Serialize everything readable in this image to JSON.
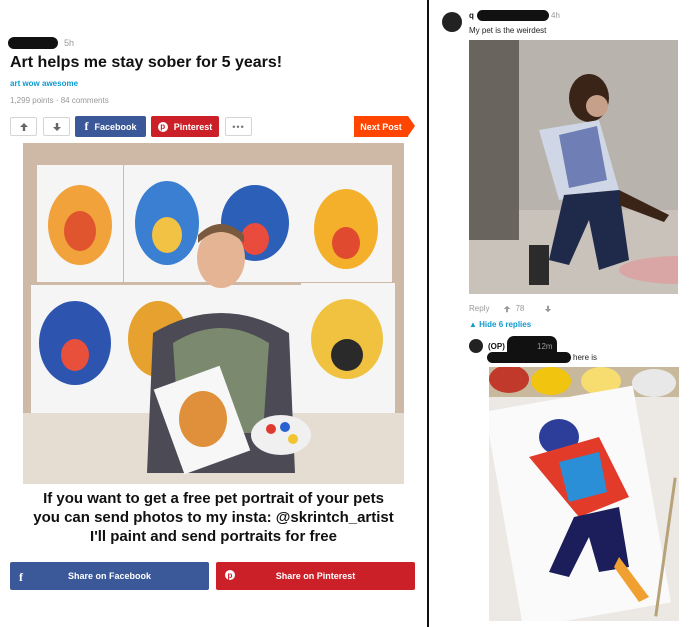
{
  "post": {
    "time": "5h",
    "title": "Art helps me stay sober for 5 years!",
    "section": "art wow awesome",
    "meta": "1,299 points · 84 comments",
    "caption_lines": [
      "If you want to get a free pet portrait of your pets",
      "you can send photos to my insta: @skrintch_artist",
      "I'll paint and send portraits for free"
    ]
  },
  "toolbar": {
    "upvote_icon": "up-arrow-icon",
    "downvote_icon": "down-arrow-icon",
    "facebook_label": "Facebook",
    "pinterest_label": "Pinterest",
    "more_label": "•••",
    "next_label": "Next Post"
  },
  "bottom_share": {
    "facebook_label": "Share on Facebook",
    "pinterest_label": "Share on Pinterest"
  },
  "comments": {
    "first": {
      "name_prefix": "q",
      "time": "4h",
      "text": "My pet is the weirdest",
      "reply_label": "Reply",
      "points": "78",
      "hide_replies": "Hide 6 replies"
    },
    "reply": {
      "op_badge": "(OP)",
      "time": "12m",
      "text": "here is"
    }
  },
  "colors": {
    "accent_blue": "#0e9bd1",
    "facebook": "#3b5998",
    "pinterest": "#cb2027",
    "next_orange": "#ff4500"
  }
}
